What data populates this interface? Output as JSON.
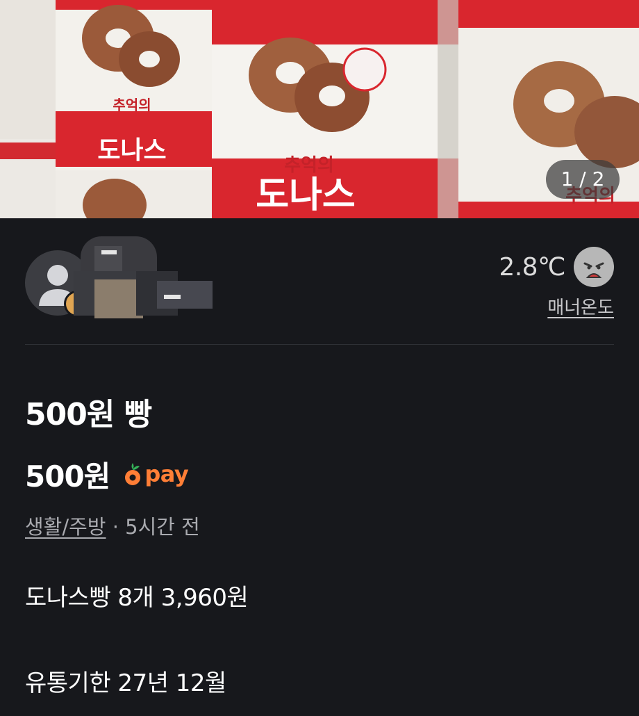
{
  "photo": {
    "counter": "1 / 2",
    "box_text_line1": "추억의",
    "box_text_line2": "도나스"
  },
  "seller": {
    "temperature": "2.8℃",
    "temperature_face": "angry-face-icon",
    "manner_label": "매너온도"
  },
  "listing": {
    "title": "500원 빵",
    "price": "500원",
    "pay_label": "pay",
    "category": "생활/주방",
    "separator": "·",
    "time": "5시간 전",
    "description_line1": "도나스빵 8개 3,960원",
    "description_line2": "유통기한 27년 12월"
  },
  "colors": {
    "background": "#17181c",
    "pay_orange": "#ff7e36",
    "pay_green": "#35b158",
    "box_red": "#d9262e"
  }
}
